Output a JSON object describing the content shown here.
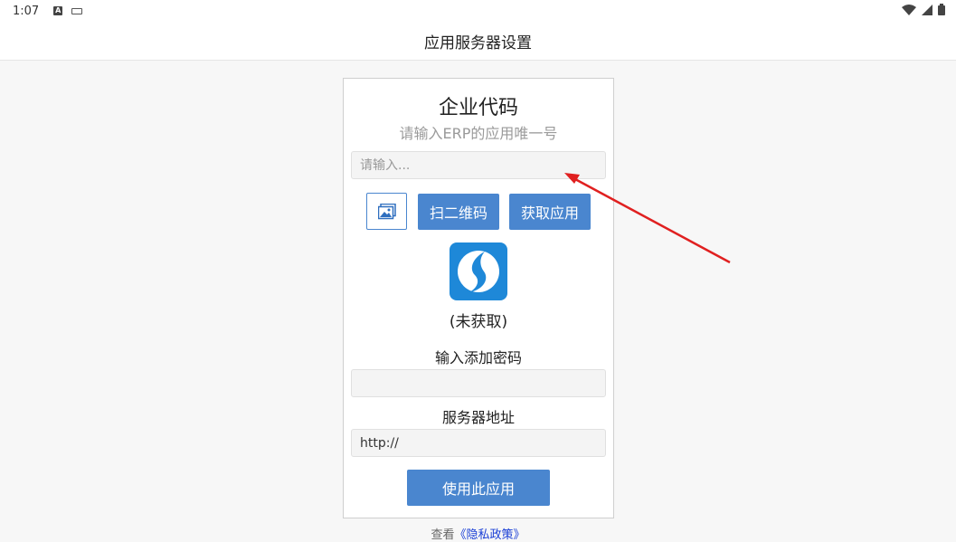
{
  "status_bar": {
    "time": "1:07"
  },
  "app_bar": {
    "title": "应用服务器设置"
  },
  "card": {
    "title": "企业代码",
    "subtitle": "请输入ERP的应用唯一号",
    "code_input": {
      "placeholder": "请输入...",
      "value": ""
    },
    "scan_button": "扫二维码",
    "fetch_button": "获取应用",
    "app_status": "(未获取)",
    "password_label": "输入添加密码",
    "password_input": {
      "value": ""
    },
    "server_label": "服务器地址",
    "server_input": {
      "value": "http://"
    },
    "use_button": "使用此应用"
  },
  "footer": {
    "prefix": "查看",
    "link": "《隐私政策》"
  },
  "colors": {
    "accent": "#4a86cf",
    "logo": "#1e88d8",
    "annotation_arrow": "#e02020"
  },
  "icons": [
    "image-icon",
    "wifi-icon",
    "signal-icon",
    "battery-icon",
    "app-logo-icon"
  ]
}
